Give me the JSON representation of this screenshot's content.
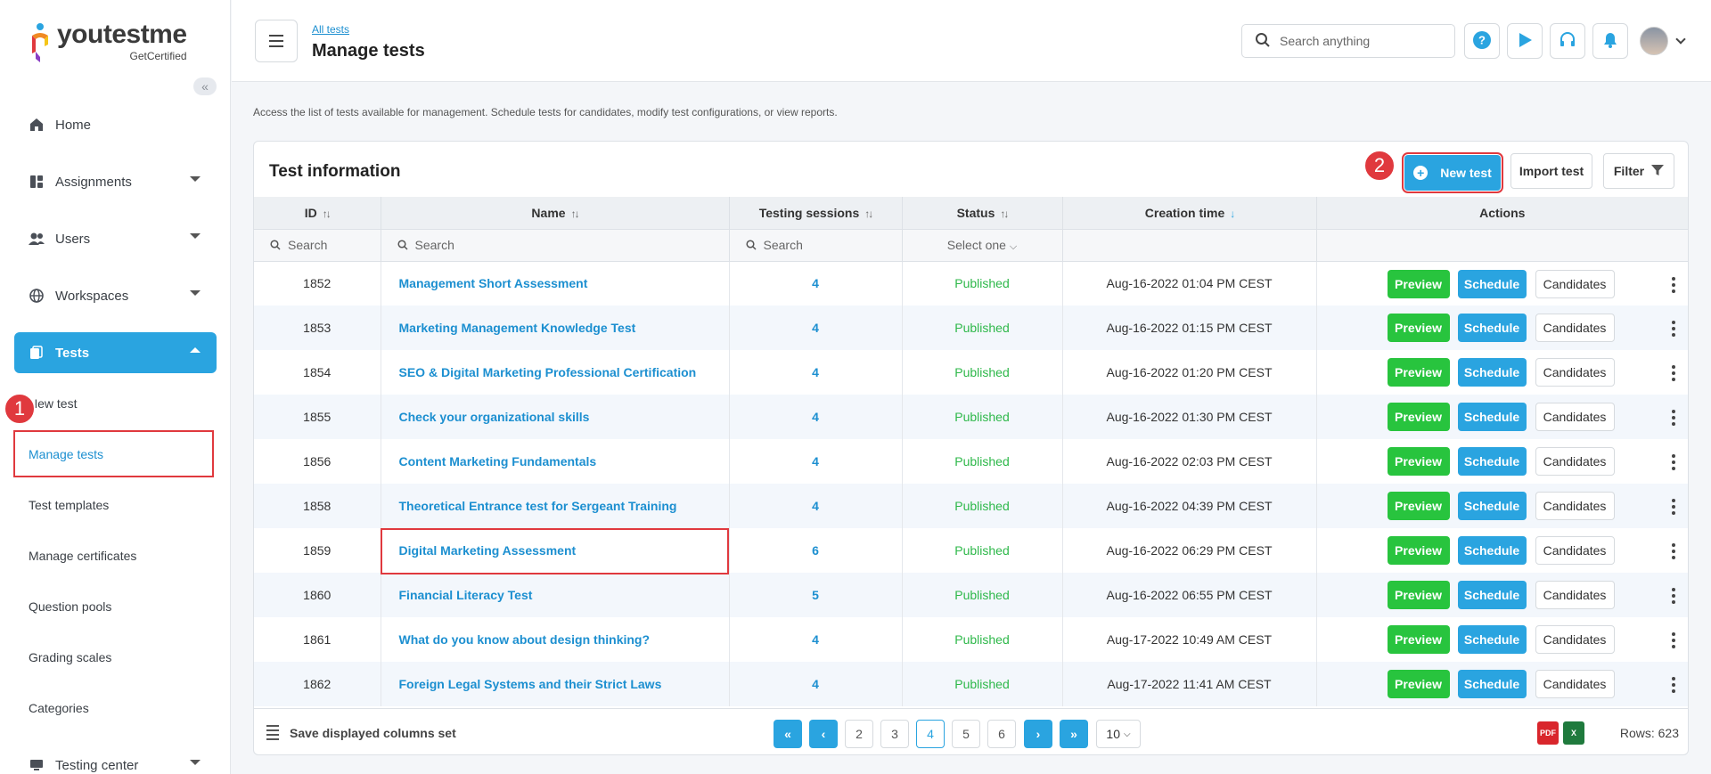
{
  "logo": {
    "main": "youtestme",
    "sub": "GetCertified"
  },
  "sidebar": {
    "items": [
      {
        "label": "Home",
        "icon": "home-icon"
      },
      {
        "label": "Assignments",
        "icon": "assignments-icon"
      },
      {
        "label": "Users",
        "icon": "users-icon"
      },
      {
        "label": "Workspaces",
        "icon": "globe-icon"
      },
      {
        "label": "Tests",
        "icon": "tests-icon"
      },
      {
        "label": "Testing center",
        "icon": "testing-center-icon"
      }
    ],
    "sub_items": [
      "New test",
      "Manage tests",
      "Test templates",
      "Manage certificates",
      "Question pools",
      "Grading scales",
      "Categories"
    ],
    "badges": [
      "1",
      "2"
    ]
  },
  "header": {
    "breadcrumb": "All tests",
    "title": "Manage tests",
    "search_placeholder": "Search anything"
  },
  "description": "Access the list of tests available for management. Schedule tests for candidates, modify test configurations, or view reports.",
  "card": {
    "title": "Test information",
    "new_test": "New test",
    "import_test": "Import test",
    "filter": "Filter"
  },
  "table": {
    "columns": [
      "ID",
      "Name",
      "Testing sessions",
      "Status",
      "Creation time",
      "Actions"
    ],
    "search_placeholder": "Search",
    "status_select": "Select one",
    "action_labels": {
      "preview": "Preview",
      "schedule": "Schedule",
      "candidates": "Candidates"
    },
    "rows": [
      {
        "id": "1852",
        "name": "Management Short Assessment",
        "sessions": "4",
        "status": "Published",
        "created": "Aug-16-2022 01:04 PM CEST"
      },
      {
        "id": "1853",
        "name": "Marketing Management Knowledge Test",
        "sessions": "4",
        "status": "Published",
        "created": "Aug-16-2022 01:15 PM CEST"
      },
      {
        "id": "1854",
        "name": "SEO & Digital Marketing Professional Certification",
        "sessions": "4",
        "status": "Published",
        "created": "Aug-16-2022 01:20 PM CEST"
      },
      {
        "id": "1855",
        "name": "Check your organizational skills",
        "sessions": "4",
        "status": "Published",
        "created": "Aug-16-2022 01:30 PM CEST"
      },
      {
        "id": "1856",
        "name": "Content Marketing Fundamentals",
        "sessions": "4",
        "status": "Published",
        "created": "Aug-16-2022 02:03 PM CEST"
      },
      {
        "id": "1858",
        "name": "Theoretical Entrance test for Sergeant Training",
        "sessions": "4",
        "status": "Published",
        "created": "Aug-16-2022 04:39 PM CEST"
      },
      {
        "id": "1859",
        "name": "Digital Marketing Assessment",
        "sessions": "6",
        "status": "Published",
        "created": "Aug-16-2022 06:29 PM CEST"
      },
      {
        "id": "1860",
        "name": "Financial Literacy Test",
        "sessions": "5",
        "status": "Published",
        "created": "Aug-16-2022 06:55 PM CEST"
      },
      {
        "id": "1861",
        "name": "What do you know about design thinking?",
        "sessions": "4",
        "status": "Published",
        "created": "Aug-17-2022 10:49 AM CEST"
      },
      {
        "id": "1862",
        "name": "Foreign Legal Systems and their Strict Laws",
        "sessions": "4",
        "status": "Published",
        "created": "Aug-17-2022 11:41 AM CEST"
      }
    ]
  },
  "footer": {
    "save_columns": "Save displayed columns set",
    "pages": [
      "2",
      "3",
      "4",
      "5",
      "6"
    ],
    "current_page": "4",
    "rows_per_page": "10",
    "rows_count": "Rows: 623"
  },
  "colors": {
    "accent": "#2aa4e0",
    "success": "#28c43e",
    "highlight": "#e0393e"
  }
}
